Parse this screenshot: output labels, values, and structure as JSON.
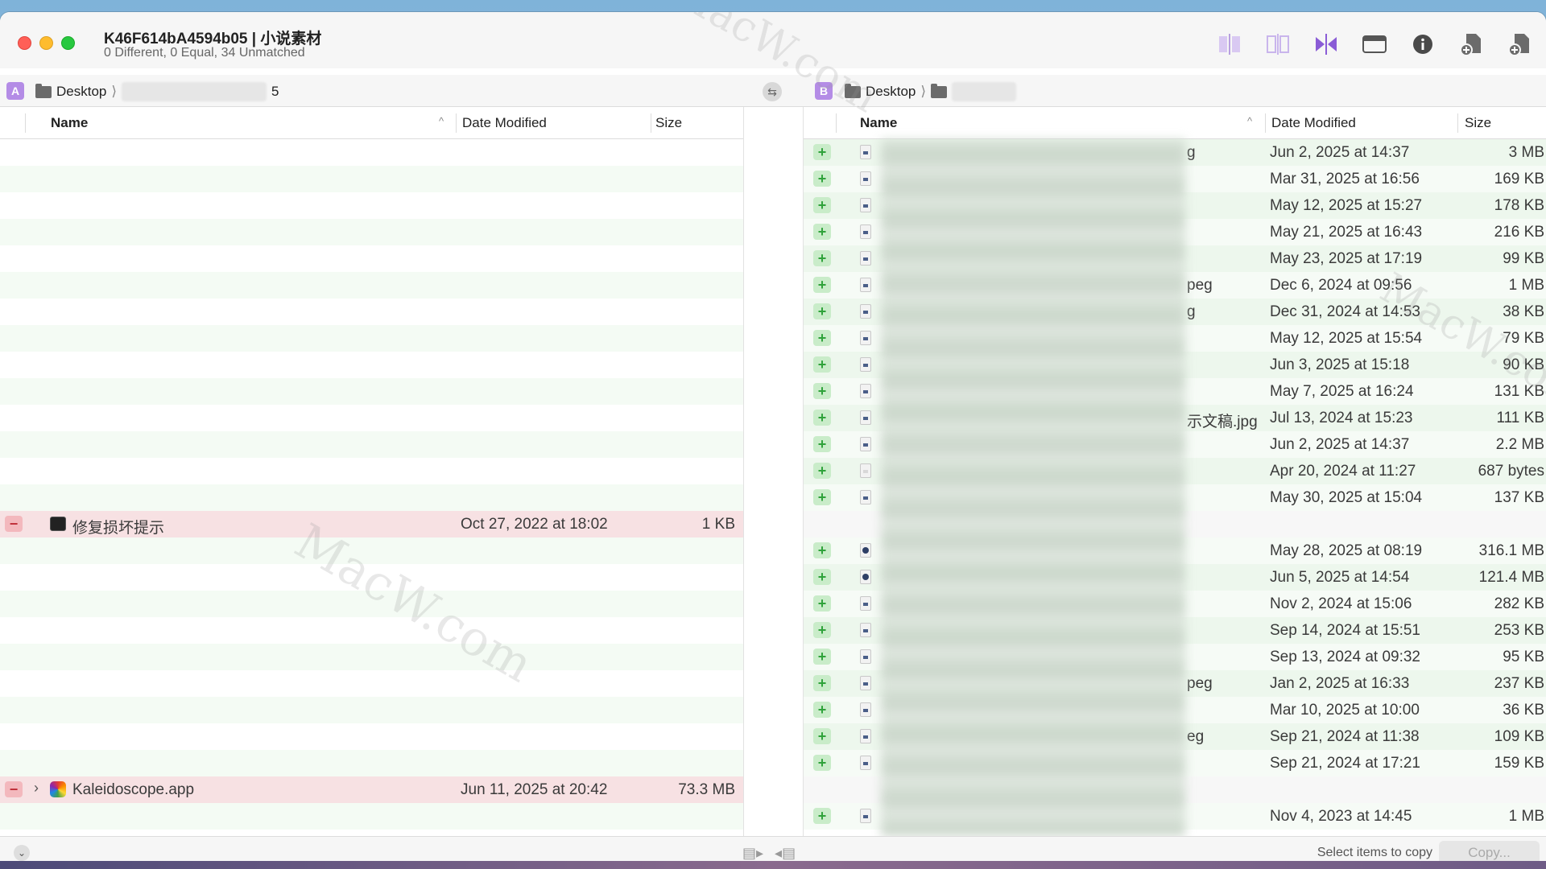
{
  "window": {
    "title": "K46F614bA4594b05 | 小说素材",
    "subtitle": "0 Different, 0 Equal, 34 Unmatched"
  },
  "pathbar": {
    "left_badge": "A",
    "right_badge": "B",
    "left_path_root": "Desktop",
    "left_path_tail": "5",
    "right_path_root": "Desktop"
  },
  "columns": {
    "name": "Name",
    "date": "Date Modified",
    "size": "Size"
  },
  "left_rows": [
    {
      "type": "empty"
    },
    {
      "type": "empty"
    },
    {
      "type": "empty"
    },
    {
      "type": "empty"
    },
    {
      "type": "empty"
    },
    {
      "type": "empty"
    },
    {
      "type": "empty"
    },
    {
      "type": "empty"
    },
    {
      "type": "empty"
    },
    {
      "type": "empty"
    },
    {
      "type": "empty"
    },
    {
      "type": "empty"
    },
    {
      "type": "empty"
    },
    {
      "type": "empty"
    },
    {
      "type": "removed",
      "icon": "terminal-icon",
      "name": "修复损坏提示",
      "date": "Oct 27, 2022 at 18:02",
      "size": "1 KB"
    },
    {
      "type": "empty"
    },
    {
      "type": "empty"
    },
    {
      "type": "empty"
    },
    {
      "type": "empty"
    },
    {
      "type": "empty"
    },
    {
      "type": "empty"
    },
    {
      "type": "empty"
    },
    {
      "type": "empty"
    },
    {
      "type": "empty"
    },
    {
      "type": "removed",
      "icon": "app-icon",
      "expandable": true,
      "name": "Kaleidoscope.app",
      "date": "Jun 11, 2025 at 20:42",
      "size": "73.3 MB"
    },
    {
      "type": "empty"
    }
  ],
  "right_rows": [
    {
      "type": "added",
      "icon": "image-file-icon",
      "name_tail": "g",
      "date": "Jun 2, 2025 at 14:37",
      "size": "3 MB"
    },
    {
      "type": "added",
      "icon": "image-file-icon",
      "name_tail": "",
      "date": "Mar 31, 2025 at 16:56",
      "size": "169 KB"
    },
    {
      "type": "added",
      "icon": "image-file-icon",
      "name_tail": "",
      "date": "May 12, 2025 at 15:27",
      "size": "178 KB"
    },
    {
      "type": "added",
      "icon": "image-file-icon",
      "name_tail": "",
      "date": "May 21, 2025 at 16:43",
      "size": "216 KB"
    },
    {
      "type": "added",
      "icon": "image-file-icon",
      "name_tail": "",
      "date": "May 23, 2025 at 17:19",
      "size": "99 KB"
    },
    {
      "type": "added",
      "icon": "image-file-icon",
      "name_tail": "peg",
      "date": "Dec 6, 2024 at 09:56",
      "size": "1 MB"
    },
    {
      "type": "added",
      "icon": "image-file-icon",
      "name_tail": "g",
      "date": "Dec 31, 2024 at 14:53",
      "size": "38 KB"
    },
    {
      "type": "added",
      "icon": "image-file-icon",
      "name_tail": "",
      "date": "May 12, 2025 at 15:54",
      "size": "79 KB"
    },
    {
      "type": "added",
      "icon": "image-file-icon",
      "name_tail": "",
      "date": "Jun 3, 2025 at 15:18",
      "size": "90 KB"
    },
    {
      "type": "added",
      "icon": "image-file-icon",
      "name_tail": "",
      "date": "May 7, 2025 at 16:24",
      "size": "131 KB"
    },
    {
      "type": "added",
      "icon": "image-file-icon",
      "name_tail": "示文稿.jpg",
      "date": "Jul 13, 2024 at 15:23",
      "size": "111 KB"
    },
    {
      "type": "added",
      "icon": "image-file-icon",
      "name_tail": "",
      "date": "Jun 2, 2025 at 14:37",
      "size": "2.2 MB"
    },
    {
      "type": "added",
      "icon": "document-file-icon",
      "name_tail": "",
      "date": "Apr 20, 2024 at 11:27",
      "size": "687 bytes"
    },
    {
      "type": "added",
      "icon": "image-file-icon",
      "name_tail": "",
      "date": "May 30, 2025 at 15:04",
      "size": "137 KB"
    },
    {
      "type": "blank"
    },
    {
      "type": "added",
      "icon": "video-file-icon",
      "name_tail": "",
      "date": "May 28, 2025 at 08:19",
      "size": "316.1 MB"
    },
    {
      "type": "added",
      "icon": "video-file-icon",
      "name_tail": "",
      "date": "Jun 5, 2025 at 14:54",
      "size": "121.4 MB"
    },
    {
      "type": "added",
      "icon": "image-file-icon",
      "name_tail": "",
      "date": "Nov 2, 2024 at 15:06",
      "size": "282 KB"
    },
    {
      "type": "added",
      "icon": "image-file-icon",
      "name_tail": "",
      "date": "Sep 14, 2024 at 15:51",
      "size": "253 KB"
    },
    {
      "type": "added",
      "icon": "image-file-icon",
      "name_tail": "",
      "date": "Sep 13, 2024 at 09:32",
      "size": "95 KB"
    },
    {
      "type": "added",
      "icon": "image-file-icon",
      "name_tail": "peg",
      "date": "Jan 2, 2025 at 16:33",
      "size": "237 KB"
    },
    {
      "type": "added",
      "icon": "image-file-icon",
      "name_tail": "",
      "date": "Mar 10, 2025 at 10:00",
      "size": "36 KB"
    },
    {
      "type": "added",
      "icon": "image-file-icon",
      "name_tail": "eg",
      "date": "Sep 21, 2024 at 11:38",
      "size": "109 KB"
    },
    {
      "type": "added",
      "icon": "image-file-icon",
      "name_tail": "",
      "date": "Sep 21, 2024 at 17:21",
      "size": "159 KB"
    },
    {
      "type": "blank"
    },
    {
      "type": "added",
      "icon": "image-file-icon",
      "name_tail": "",
      "date": "Nov 4, 2023 at 14:45",
      "size": "1 MB"
    }
  ],
  "statusbar": {
    "status": "Select items to copy",
    "copy_button": "Copy..."
  },
  "watermark": "MacW.com",
  "colors": {
    "removed_row": "#f7e1e3",
    "added_row": "#edf7ed",
    "minus_badge": "#f3b8bd",
    "plus_badge": "#c9ecc9",
    "accent_purple": "#b48ce6"
  }
}
